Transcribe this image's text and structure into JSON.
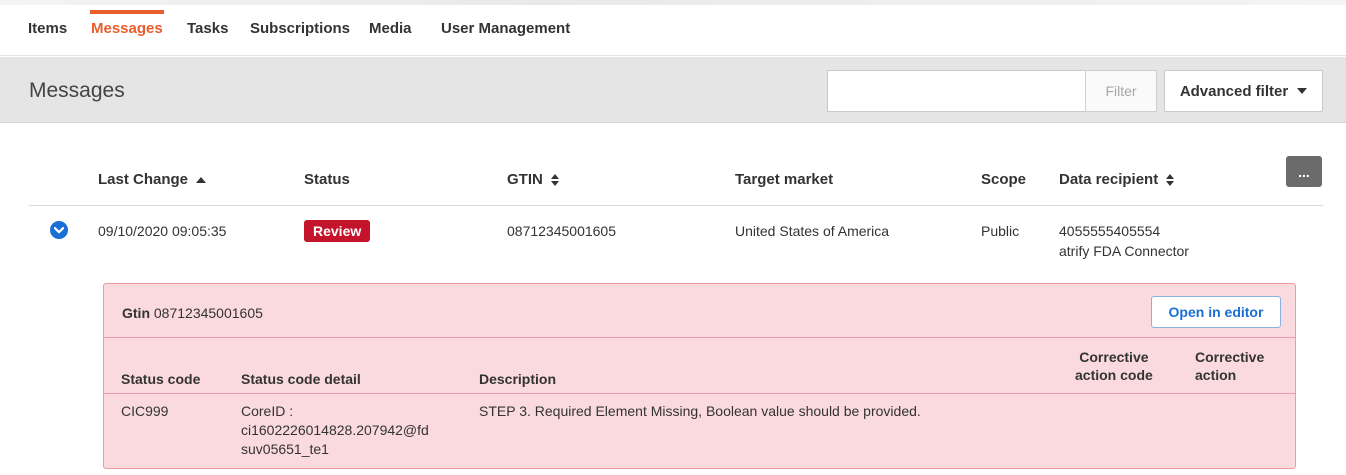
{
  "nav": {
    "tabs": [
      {
        "label": "Items"
      },
      {
        "label": "Messages"
      },
      {
        "label": "Tasks"
      },
      {
        "label": "Subscriptions"
      },
      {
        "label": "Media"
      },
      {
        "label": "User Management"
      }
    ],
    "active_tab": "Messages"
  },
  "header": {
    "title": "Messages",
    "filter_value": "",
    "filter_button": "Filter",
    "advanced_filter": "Advanced filter"
  },
  "table": {
    "columns": {
      "last_change": "Last Change",
      "status": "Status",
      "gtin": "GTIN",
      "target_market": "Target market",
      "scope": "Scope",
      "data_recipient": "Data recipient"
    },
    "more_button": "...",
    "rows": [
      {
        "last_change": "09/10/2020 09:05:35",
        "status": "Review",
        "gtin": "08712345001605",
        "target_market": "United States of America",
        "scope": "Public",
        "recipient_gln": "4055555405554",
        "recipient_name": "atrify FDA Connector"
      }
    ]
  },
  "detail": {
    "gtin_label": "Gtin",
    "gtin_value": "08712345001605",
    "open_button": "Open in editor",
    "columns": {
      "status_code": "Status code",
      "status_code_detail": "Status code detail",
      "description": "Description",
      "corrective_code_1": "Corrective",
      "corrective_code_2": "action code",
      "corrective_action_1": "Corrective",
      "corrective_action_2": "action"
    },
    "rows": [
      {
        "status_code": "CIC999",
        "detail_line1": "CoreID :",
        "detail_line2": "ci1602226014828.207942@fd",
        "detail_line3": "suv05651_te1",
        "description": "STEP 3. Required Element Missing, Boolean value should be provided.",
        "corrective_code": "",
        "corrective_action": ""
      }
    ]
  },
  "colors": {
    "accent": "#e85e2c",
    "review_badge": "#c4142b",
    "link_blue": "#1a6fd6",
    "error_panel": "#fadadf"
  }
}
